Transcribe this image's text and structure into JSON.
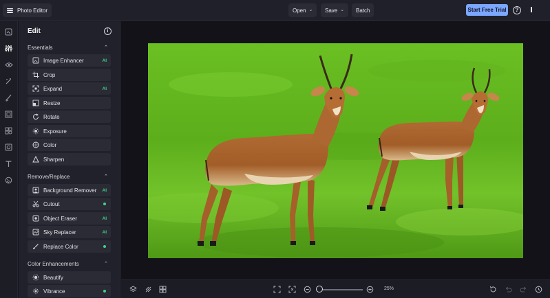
{
  "app": {
    "title": "Photo Editor"
  },
  "toolbar": {
    "open_label": "Open",
    "save_label": "Save",
    "batch_label": "Batch",
    "trial_label": "Start Free Trial",
    "help_icon": "help-circle-icon"
  },
  "panel": {
    "title": "Edit",
    "sections": [
      {
        "title": "Essentials",
        "items": [
          {
            "label": "Image Enhancer",
            "icon": "image-enhancer-icon",
            "badge": "AI"
          },
          {
            "label": "Crop",
            "icon": "crop-icon",
            "badge": ""
          },
          {
            "label": "Expand",
            "icon": "expand-icon",
            "badge": "AI"
          },
          {
            "label": "Resize",
            "icon": "resize-icon",
            "badge": ""
          },
          {
            "label": "Rotate",
            "icon": "rotate-icon",
            "badge": ""
          },
          {
            "label": "Exposure",
            "icon": "exposure-icon",
            "badge": ""
          },
          {
            "label": "Color",
            "icon": "color-icon",
            "badge": ""
          },
          {
            "label": "Sharpen",
            "icon": "sharpen-icon",
            "badge": ""
          }
        ]
      },
      {
        "title": "Remove/Replace",
        "items": [
          {
            "label": "Background Remover",
            "icon": "background-remover-icon",
            "badge": "AI"
          },
          {
            "label": "Cutout",
            "icon": "cutout-icon",
            "badge": "dot"
          },
          {
            "label": "Object Eraser",
            "icon": "object-eraser-icon",
            "badge": "AI"
          },
          {
            "label": "Sky Replacer",
            "icon": "sky-replacer-icon",
            "badge": "AI"
          },
          {
            "label": "Replace Color",
            "icon": "replace-color-icon",
            "badge": "dot"
          }
        ]
      },
      {
        "title": "Color Enhancements",
        "items": [
          {
            "label": "Beautify",
            "icon": "beautify-icon",
            "badge": ""
          },
          {
            "label": "Vibrance",
            "icon": "vibrance-icon",
            "badge": "dot"
          }
        ]
      }
    ]
  },
  "zoom": {
    "value_label": "25%",
    "level": 0.05
  },
  "colors": {
    "accent": "#7ba7ff",
    "ai_badge": "#3fd38b",
    "background": "#16161d"
  }
}
